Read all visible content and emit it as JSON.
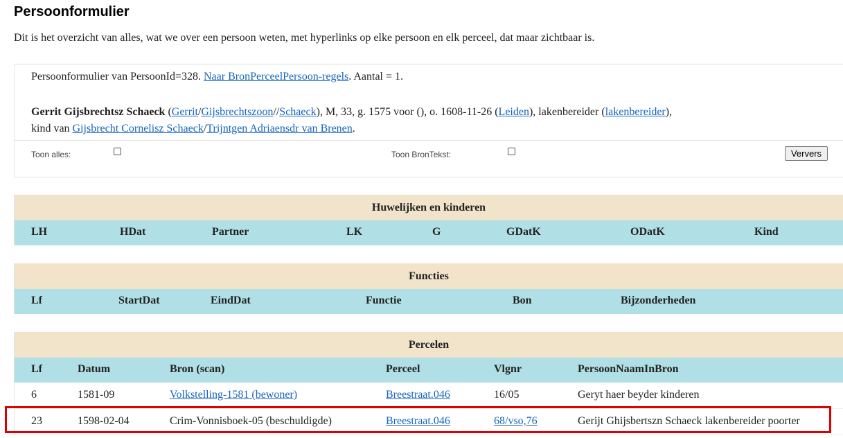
{
  "page": {
    "title": "Persoonformulier",
    "intro": "Dit is het overzicht van alles, wat we over een persoon weten, met hyperlinks op elke persoon en elk perceel, dat maar zichtbaar is."
  },
  "info": {
    "prefix": "Persoonformulier van PersoonId=328. ",
    "link": "Naar BronPerceelPersoon-regels",
    "suffix": ". Aantal = 1.",
    "name": "Gerrit Gijsbrechtsz Schaeck",
    "t1": " (",
    "first": "Gerrit",
    "s1": "/",
    "patronym": "Gijsbrechtszoon",
    "s2": "//",
    "surname": "Schaeck",
    "t2": "), M, 33, g. 1575 voor (), o. 1608-11-26 (",
    "place": "Leiden",
    "t3": "), lakenbereider (",
    "occupation": "lakenbereider",
    "t4": "),",
    "t5": "kind van ",
    "father": "Gijsbrecht Cornelisz Schaeck",
    "s3": "/",
    "mother": "Trijntgen Adriaensdr van Brenen",
    "t6": "."
  },
  "options": {
    "show_all": "Toon alles:",
    "show_source": "Toon BronTekst:",
    "refresh": "Ververs"
  },
  "marriages": {
    "title": "Huwelijken en kinderen",
    "columns": [
      "LH",
      "HDat",
      "Partner",
      "LK",
      "G",
      "GDatK",
      "ODatK",
      "Kind"
    ]
  },
  "functions": {
    "title": "Functies",
    "columns": [
      "Lf",
      "StartDat",
      "EindDat",
      "Functie",
      "Bon",
      "Bijzonderheden"
    ]
  },
  "parcels": {
    "title": "Percelen",
    "columns": [
      "Lf",
      "Datum",
      "Bron (scan)",
      "Perceel",
      "Vlgnr",
      "PersoonNaamInBron"
    ],
    "rows": [
      {
        "lf": "6",
        "datum": "1581-09",
        "bron": "Volkstelling-1581 (bewoner)",
        "perceel": "Breestraat.046",
        "vlgnr": "16/05",
        "naam": "Geryt haer beyder kinderen"
      },
      {
        "lf": "23",
        "datum": "1598-02-04",
        "bron": "Crim-Vonnisboek-05 (beschuldigde)",
        "perceel": "Breestraat.046",
        "vlgnr": "68/vso,76",
        "naam": "Gerijt Ghijsbertszn Schaeck lakenbereider poorter"
      }
    ]
  }
}
